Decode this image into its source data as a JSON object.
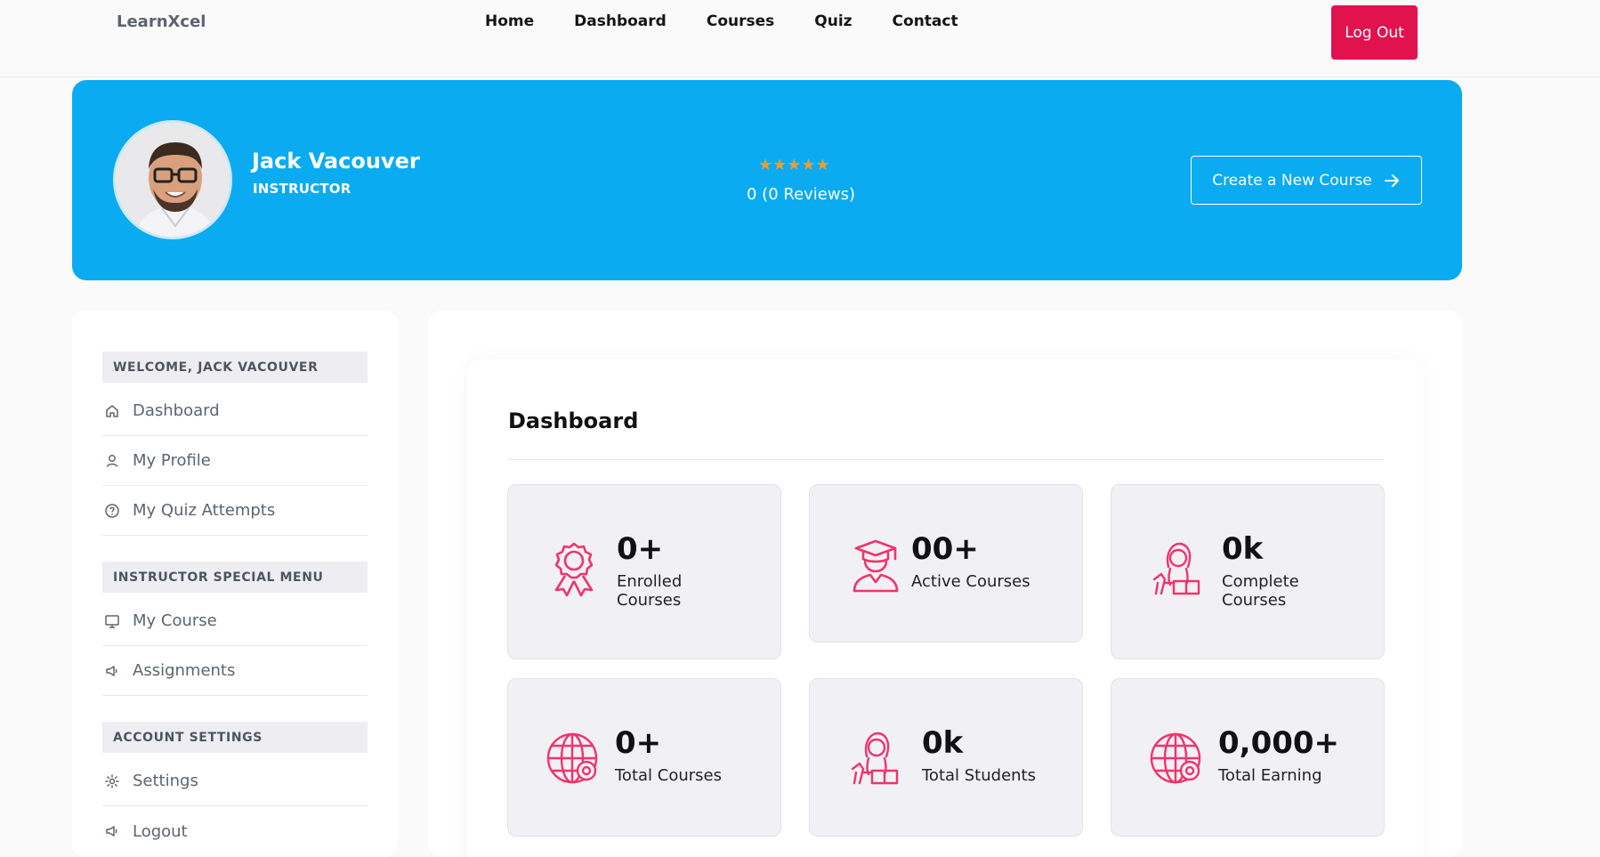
{
  "header": {
    "brand": "LearnXcel",
    "nav": [
      "Home",
      "Dashboard",
      "Courses",
      "Quiz",
      "Contact"
    ],
    "logout_label": "Log Out"
  },
  "profile": {
    "name": "Jack Vacouver",
    "role": "INSTRUCTOR",
    "stars": "★★★★★",
    "reviews": "0 (0 Reviews)",
    "create_label": "Create a New Course"
  },
  "sidebar": {
    "welcome": "WELCOME, JACK VACOUVER",
    "items1": [
      {
        "label": "Dashboard",
        "icon": "home-icon"
      },
      {
        "label": "My Profile",
        "icon": "user-icon"
      },
      {
        "label": "My Quiz Attempts",
        "icon": "help-circle-icon"
      }
    ],
    "instructor_heading": "INSTRUCTOR SPECIAL MENU",
    "items2": [
      {
        "label": "My Course",
        "icon": "monitor-icon"
      },
      {
        "label": "Assignments",
        "icon": "megaphone-icon"
      }
    ],
    "account_heading": "ACCOUNT SETTINGS",
    "items3": [
      {
        "label": "Settings",
        "icon": "gear-icon"
      },
      {
        "label": "Logout",
        "icon": "megaphone-icon"
      }
    ]
  },
  "dashboard": {
    "title": "Dashboard",
    "cards": [
      {
        "value": "0+",
        "label": "Enrolled Courses",
        "icon": "award-ribbon-icon"
      },
      {
        "value": "00+",
        "label": "Active Courses",
        "icon": "graduate-icon"
      },
      {
        "value": "0k",
        "label": "Complete Courses",
        "icon": "student-reading-icon"
      },
      {
        "value": "0+",
        "label": "Total Courses",
        "icon": "globe-icon"
      },
      {
        "value": "0k",
        "label": "Total Students",
        "icon": "student-reading-icon"
      },
      {
        "value": "0,000+",
        "label": "Total Earning",
        "icon": "globe-icon"
      }
    ]
  },
  "colors": {
    "accent": "#e2124f",
    "banner": "#0aabf1",
    "icon_pink": "#f0346a",
    "star": "#f79a2a"
  }
}
